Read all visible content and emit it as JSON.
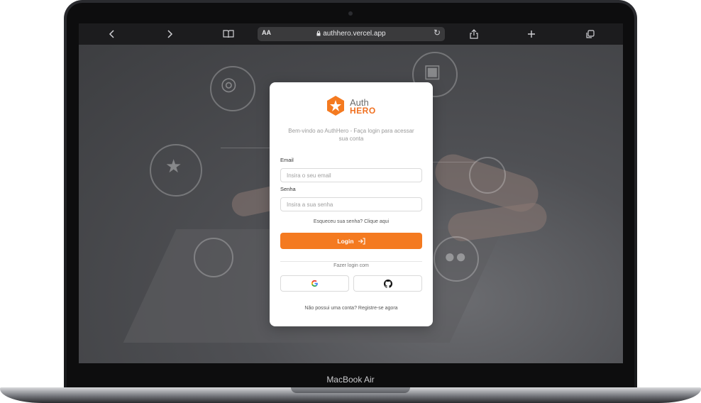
{
  "device": {
    "label": "MacBook Air"
  },
  "browser": {
    "text_size_label": "AA",
    "url": "authhero.vercel.app",
    "icons": [
      "back-icon",
      "forward-icon",
      "bookmarks-icon",
      "lock-icon",
      "reload-icon",
      "share-icon",
      "new-tab-icon",
      "tabs-icon"
    ]
  },
  "login": {
    "logo_top": "Auth",
    "logo_bottom": "HERO",
    "subtitle": "Bem-vindo ao AuthHero - Faça login para acessar sua conta",
    "email_label": "Email",
    "email_placeholder": "Insira o seu email",
    "password_label": "Senha",
    "password_placeholder": "Insira a sua senha",
    "forgot_text": "Esqueceu sua senha? Clique aqui",
    "login_button": "Login",
    "social_divider": "Fazer login com",
    "register_text": "Não possui uma conta? Registre-se agora",
    "accent_color": "#f47a20"
  }
}
